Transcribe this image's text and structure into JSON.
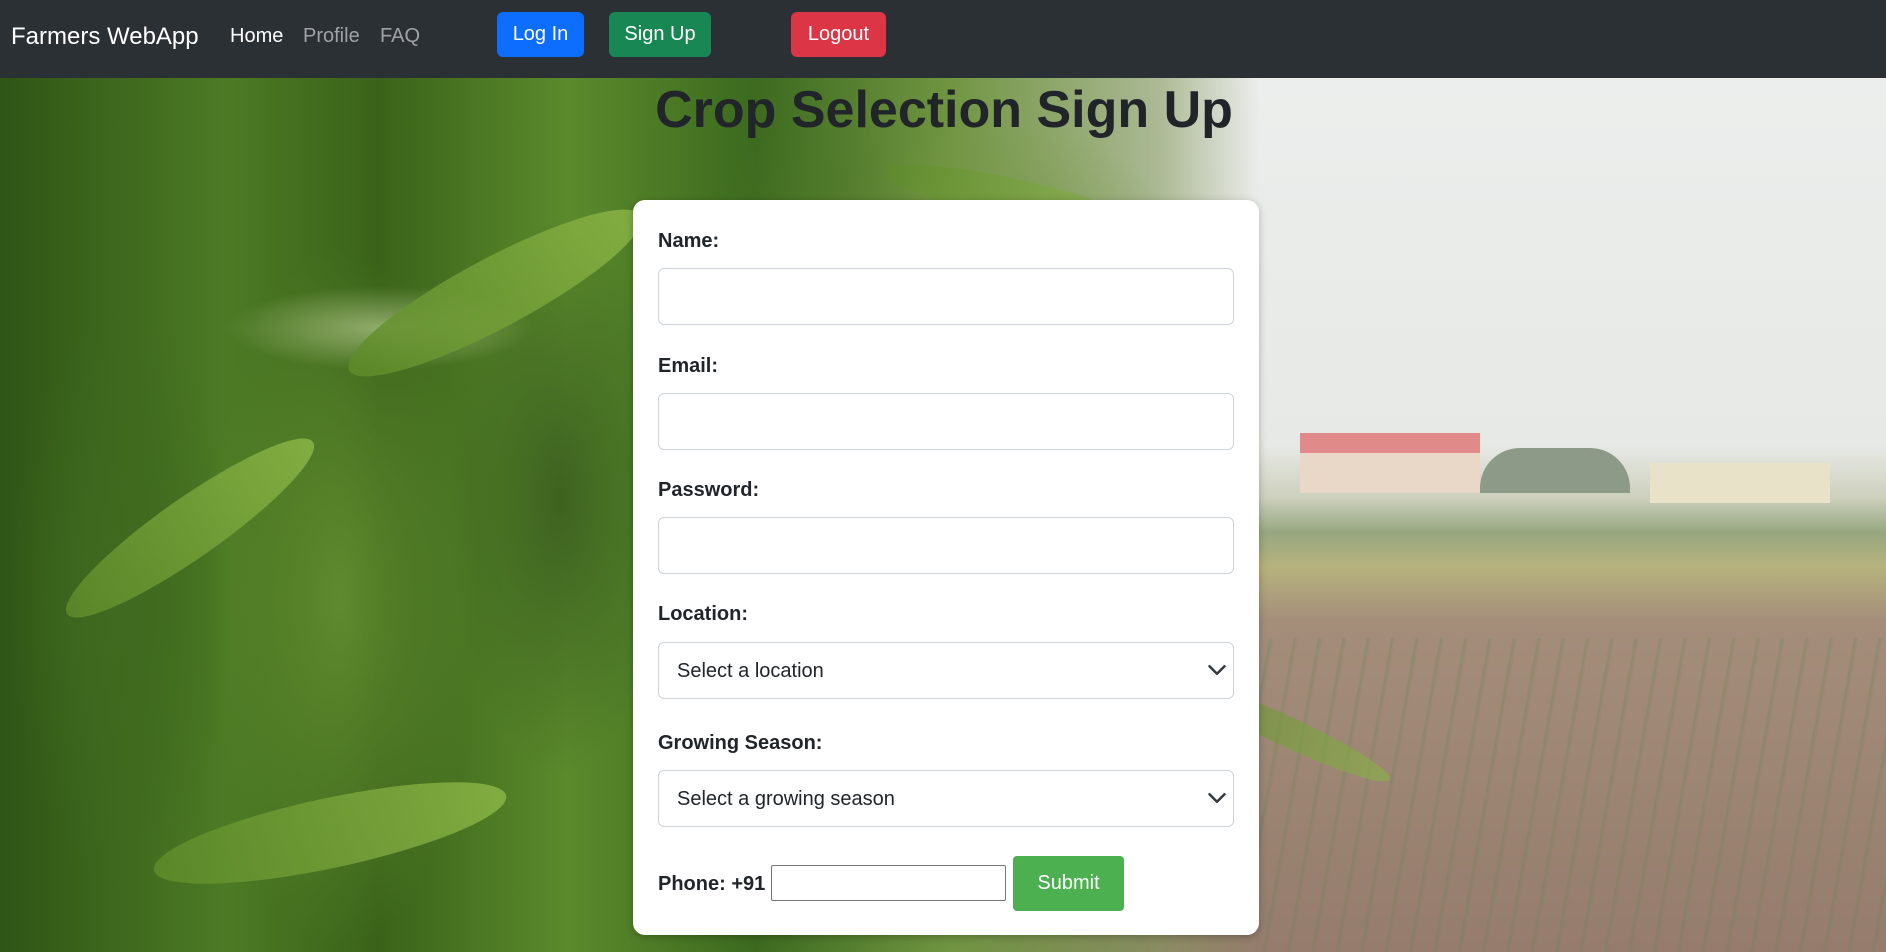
{
  "navbar": {
    "brand": "Farmers WebApp",
    "links": [
      {
        "label": "Home",
        "active": true
      },
      {
        "label": "Profile",
        "active": false
      },
      {
        "label": "FAQ",
        "active": false
      }
    ],
    "buttons": {
      "login": "Log In",
      "signup": "Sign Up",
      "logout": "Logout"
    }
  },
  "page": {
    "title": "Crop Selection Sign Up"
  },
  "form": {
    "name_label": "Name:",
    "name_value": "",
    "email_label": "Email:",
    "email_value": "",
    "password_label": "Password:",
    "password_value": "",
    "location_label": "Location:",
    "location_selected": "Select a location",
    "season_label": "Growing Season:",
    "season_selected": "Select a growing season",
    "phone_label": "Phone: +91",
    "phone_value": "",
    "submit_label": "Submit"
  },
  "colors": {
    "navbar_bg": "#2b3035",
    "login_btn": "#0d6efd",
    "signup_btn": "#198754",
    "logout_btn": "#dc3545",
    "submit_btn": "#4caf50"
  }
}
